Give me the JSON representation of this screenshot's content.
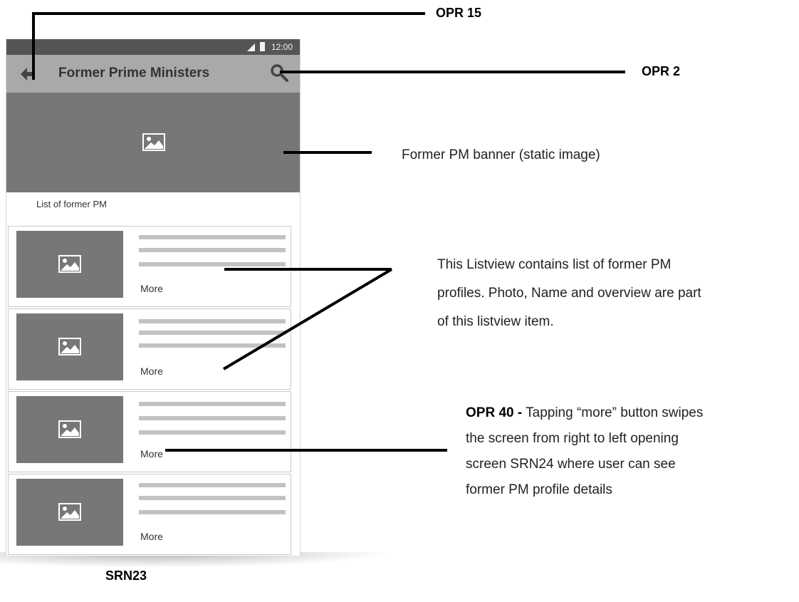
{
  "phone": {
    "status_time": "12:00",
    "title": "Former Prime Ministers",
    "list_heading": "List of former PM",
    "items": [
      {
        "more_label": "More"
      },
      {
        "more_label": "More"
      },
      {
        "more_label": "More"
      },
      {
        "more_label": "More"
      }
    ]
  },
  "annotations": {
    "opr15": "OPR 15",
    "opr2": "OPR 2",
    "banner_note": "Former PM banner (static image)",
    "listview_note_lines": [
      "This Listview contains list of former PM",
      "profiles. Photo, Name and overview are part",
      "of this listview item."
    ],
    "opr40_label": "OPR 40 -",
    "opr40_note_first": " Tapping “more” button swipes",
    "opr40_note_lines": [
      "the screen from right to left opening",
      "screen SRN24 where user can see",
      "former PM profile details"
    ],
    "screen_id": "SRN23"
  },
  "colors": {
    "status_bar": "#555555",
    "app_bar": "#a9a9a9",
    "image_placeholder": "#777777"
  },
  "icons": [
    "back-arrow-icon",
    "search-icon",
    "image-icon",
    "signal-icon",
    "battery-icon"
  ]
}
